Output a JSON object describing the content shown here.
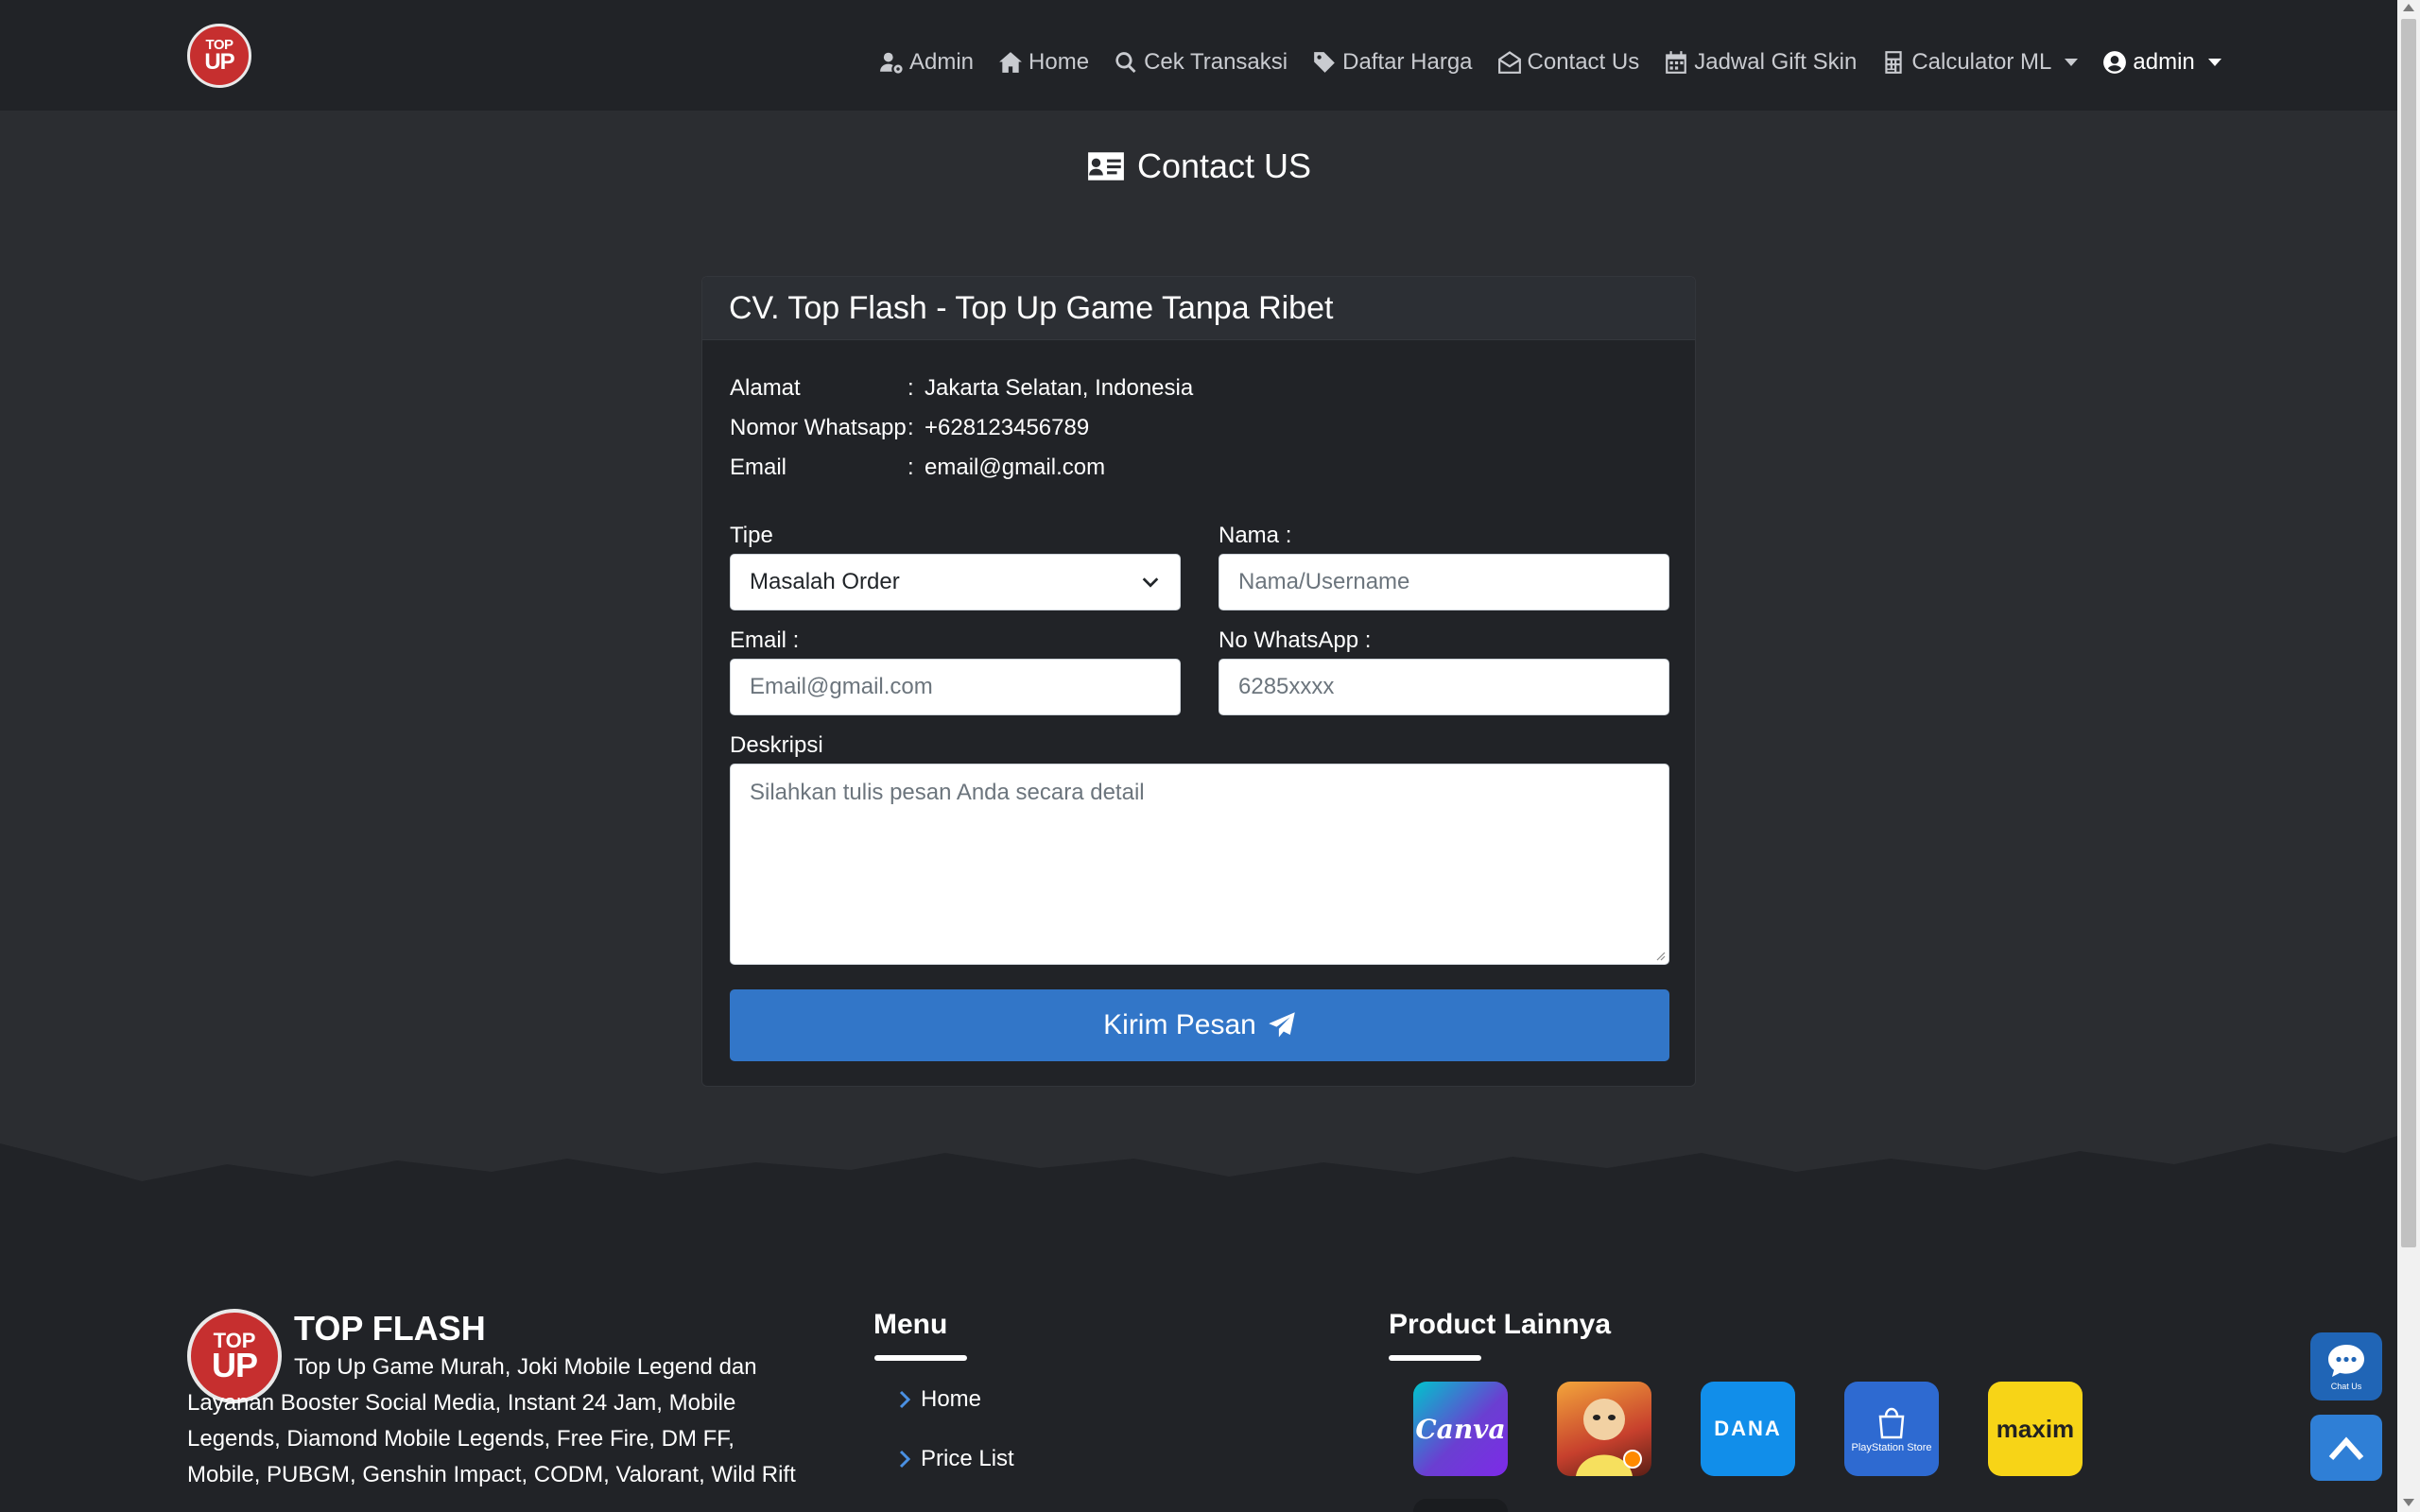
{
  "brand": {
    "logo_top": "TOP",
    "logo_bottom": "UP"
  },
  "nav": {
    "items": [
      {
        "label": "Admin",
        "icon": "user-gear-icon"
      },
      {
        "label": "Home",
        "icon": "home-icon"
      },
      {
        "label": "Cek Transaksi",
        "icon": "search-icon"
      },
      {
        "label": "Daftar Harga",
        "icon": "tag-icon"
      },
      {
        "label": "Contact Us",
        "icon": "envelope-open-icon"
      },
      {
        "label": "Jadwal Gift Skin",
        "icon": "calendar-icon"
      },
      {
        "label": "Calculator ML",
        "icon": "calculator-icon"
      }
    ],
    "user_label": "admin"
  },
  "page": {
    "title": "Contact US"
  },
  "card": {
    "header": "CV. Top Flash - Top Up Game Tanpa Ribet",
    "info": [
      {
        "key": "Alamat",
        "sep": ":",
        "value": "Jakarta Selatan, Indonesia"
      },
      {
        "key": "Nomor Whatsapp",
        "sep": ":",
        "value": "+628123456789"
      },
      {
        "key": "Email",
        "sep": ":",
        "value": "email@gmail.com"
      }
    ]
  },
  "form": {
    "tipe_label": "Tipe",
    "tipe_value": "Masalah Order",
    "nama_label": "Nama :",
    "nama_placeholder": "Nama/Username",
    "email_label": "Email :",
    "email_placeholder": "Email@gmail.com",
    "wa_label": "No WhatsApp :",
    "wa_placeholder": "6285xxxx",
    "desc_label": "Deskripsi",
    "desc_placeholder": "Silahkan tulis pesan Anda secara detail",
    "submit_label": "Kirim Pesan"
  },
  "footer": {
    "brand": "TOP FLASH",
    "description": "Top Up Game Murah, Joki Mobile Legend dan Layanan Booster Social Media, Instant 24 Jam, Mobile Legends, Diamond Mobile Legends, Free Fire, DM FF, Mobile, PUBGM, Genshin Impact, CODM, Valorant, Wild Rift",
    "menu_heading": "Menu",
    "menu_items": [
      "Home",
      "Price List"
    ],
    "products_heading": "Product Lainnya",
    "products": [
      {
        "name": "Canva",
        "label": "Canva"
      },
      {
        "name": "game-hero",
        "label": ""
      },
      {
        "name": "DANA",
        "label": "DANA"
      },
      {
        "name": "PlayStation Store",
        "label": "PlayStation Store"
      },
      {
        "name": "maxim",
        "label": "maxim"
      }
    ]
  },
  "floating": {
    "chat_label": "Chat Us"
  },
  "colors": {
    "page_bg": "#2b2d31",
    "navbar_bg": "#212327",
    "card_bg": "#212327",
    "primary": "#3276c8",
    "logo_red": "#c62f2f"
  }
}
